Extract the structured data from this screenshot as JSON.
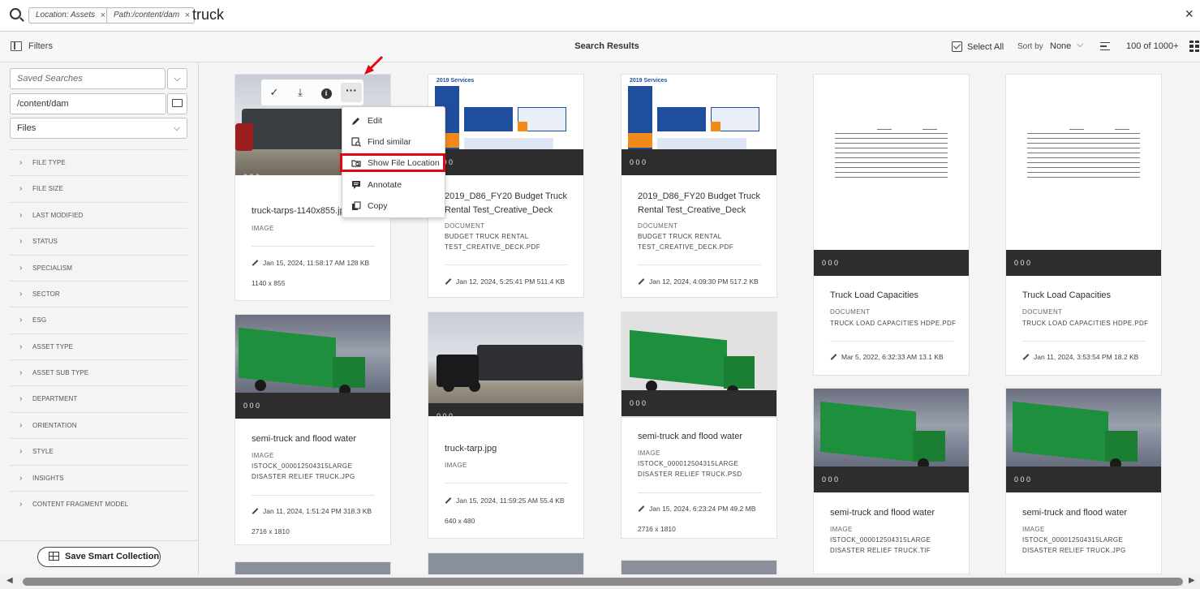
{
  "search": {
    "tags": [
      {
        "label": "Location: Assets"
      },
      {
        "label": "Path:/content/dam"
      }
    ],
    "query": "truck"
  },
  "toolbar": {
    "filters_label": "Filters",
    "title": "Search Results",
    "select_all": "Select All",
    "sort_by": "Sort by",
    "sort_value": "None",
    "count": "100 of 1000+"
  },
  "rail": {
    "saved_searches_placeholder": "Saved Searches",
    "path_value": "/content/dam",
    "type_value": "Files",
    "facets": [
      "FILE TYPE",
      "FILE SIZE",
      "LAST MODIFIED",
      "STATUS",
      "SPECIALISM",
      "SECTOR",
      "ESG",
      "ASSET TYPE",
      "ASSET SUB TYPE",
      "DEPARTMENT",
      "ORIENTATION",
      "STYLE",
      "INSIGHTS",
      "CONTENT FRAGMENT MODEL"
    ],
    "save_smart_collection": "Save Smart Collection"
  },
  "stats_text": "0  0  0",
  "cards": [
    {
      "title": "truck-tarps-1140x855.jpg",
      "type": "IMAGE",
      "file": "",
      "date": "Jan 15, 2024, 11:58:17 AM  128 KB",
      "dims": "1140 x 855"
    },
    {
      "title": "2019_D86_FY20 Budget Truck Rental Test_Creative_Deck",
      "type": "DOCUMENT",
      "file": "BUDGET TRUCK RENTAL TEST_CREATIVE_DECK.PDF",
      "date": "Jan 12, 2024, 5:25:41 PM  511.4 KB",
      "dims": ""
    },
    {
      "title": "2019_D86_FY20 Budget Truck Rental Test_Creative_Deck",
      "type": "DOCUMENT",
      "file": "BUDGET TRUCK RENTAL TEST_CREATIVE_DECK.PDF",
      "date": "Jan 12, 2024, 4:09:30 PM  517.2 KB",
      "dims": ""
    },
    {
      "title": "Truck Load Capacities",
      "type": "DOCUMENT",
      "file": "TRUCK LOAD CAPACITIES HDPE.PDF",
      "date": "Mar 5, 2022, 6:32:33 AM  13.1 KB",
      "dims": ""
    },
    {
      "title": "Truck Load Capacities",
      "type": "DOCUMENT",
      "file": "TRUCK LOAD CAPACITIES HDPE.PDF",
      "date": "Jan 11, 2024, 3:53:54 PM  18.2 KB",
      "dims": ""
    },
    {
      "title": "semi-truck and flood water",
      "type": "IMAGE",
      "file": "ISTOCK_000012504315LARGE DISASTER RELIEF TRUCK.JPG",
      "date": "Jan 11, 2024, 1:51:24 PM  318.3 KB",
      "dims": "2716 x 1810"
    },
    {
      "title": "truck-tarp.jpg",
      "type": "IMAGE",
      "file": "",
      "date": "Jan 15, 2024, 11:59:25 AM  55.4 KB",
      "dims": "640 x 480"
    },
    {
      "title": "semi-truck and flood water",
      "type": "IMAGE",
      "file": "ISTOCK_000012504315LARGE DISASTER RELIEF TRUCK.PSD",
      "date": "Jan 15, 2024, 6:23:24 PM  49.2 MB",
      "dims": "2716 x 1810"
    },
    {
      "title": "semi-truck and flood water",
      "type": "IMAGE",
      "file": "ISTOCK_000012504315LARGE DISASTER RELIEF TRUCK.TIF",
      "date": "",
      "dims": ""
    },
    {
      "title": "semi-truck and flood water",
      "type": "IMAGE",
      "file": "ISTOCK_000012504315LARGE DISASTER RELIEF TRUCK.JPG",
      "date": "",
      "dims": ""
    }
  ],
  "menu": {
    "items": [
      "Edit",
      "Find similar",
      "Show File Location",
      "Annotate",
      "Copy"
    ]
  },
  "colors": {
    "highlight": "#e30613",
    "strip": "#2d2d2d",
    "accent_green": "#1e8f3c"
  },
  "icons": [
    "search-icon",
    "close-icon",
    "sidebar-icon",
    "checkbox-icon",
    "sort-order-icon",
    "grid-icon",
    "folder-icon",
    "chevron-down-icon",
    "chevron-right-icon",
    "table-icon",
    "checkmark-icon",
    "download-icon",
    "info-icon",
    "more-icon",
    "pencil-icon",
    "find-similar-icon",
    "file-location-icon",
    "annotate-icon",
    "copy-icon",
    "arrow-icon"
  ]
}
